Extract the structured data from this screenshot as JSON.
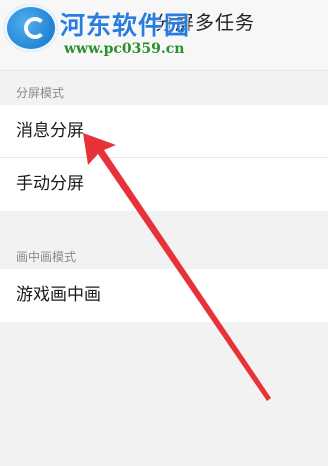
{
  "header": {
    "title": "分屏多任务"
  },
  "watermark": {
    "name": "河东软件园",
    "url": "www.pc0359.cn"
  },
  "sections": [
    {
      "label": "分屏模式",
      "items": [
        "消息分屏",
        "手动分屏"
      ]
    },
    {
      "label": "画中画模式",
      "items": [
        "游戏画中画"
      ]
    }
  ],
  "colors": {
    "arrow": "#e8323a",
    "watermark_name": "#2a7de0",
    "watermark_url": "#2b8f2b"
  }
}
